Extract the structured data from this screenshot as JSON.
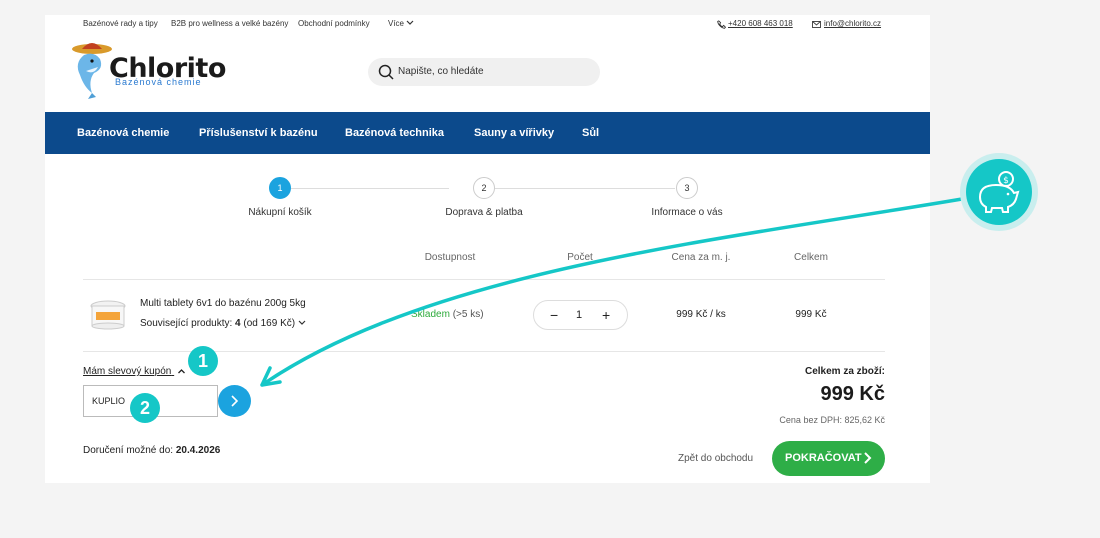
{
  "topbar": {
    "links": [
      "Bazénové rady a tipy",
      "B2B pro wellness a velké bazény",
      "Obchodní podmínky",
      "Více"
    ],
    "phone": "+420 608 463 018",
    "email": "info@chlorito.cz"
  },
  "logo": {
    "name": "Chlorito",
    "tagline": "Bazénová chemie"
  },
  "search": {
    "placeholder": "Napište, co hledáte"
  },
  "nav": [
    "Bazénová chemie",
    "Příslušenství k bazénu",
    "Bazénová technika",
    "Sauny a vířivky",
    "Sůl"
  ],
  "steps": [
    {
      "num": "1",
      "label": "Nákupní košík"
    },
    {
      "num": "2",
      "label": "Doprava & platba"
    },
    {
      "num": "3",
      "label": "Informace o vás"
    }
  ],
  "table": {
    "headers": {
      "availability": "Dostupnost",
      "count": "Počet",
      "unit_price": "Cena za m. j.",
      "total": "Celkem"
    },
    "row": {
      "name": "Multi tablety 6v1 do bazénu 200g 5kg",
      "related_prefix": "Související produkty:",
      "related_count": "4",
      "related_price": "(od 169 Kč)",
      "availability_status": "Skladem",
      "availability_detail": "(>5 ks)",
      "qty": "1",
      "unit_price": "999 Kč / ks",
      "total": "999 Kč"
    }
  },
  "coupon": {
    "toggle": "Mám slevový kupón",
    "value": "KUPLIO"
  },
  "delivery": {
    "label": "Doručení možné do:",
    "date": "20.4.2026"
  },
  "totals": {
    "label": "Celkem za zboží:",
    "value": "999 Kč",
    "net_label": "Cena bez DPH:",
    "net_value": "825,62 Kč"
  },
  "actions": {
    "back": "Zpět do obchodu",
    "continue": "POKRAČOVAT"
  },
  "badges": [
    "1",
    "2"
  ],
  "colors": {
    "nav": "#0c4a8c",
    "accent": "#1ba3df",
    "green": "#2eae47",
    "teal": "#15c7c7"
  },
  "icons": [
    "phone-icon",
    "mail-icon",
    "search-icon",
    "chevron-down-icon",
    "piggy-bank-icon",
    "arrow-icon"
  ]
}
